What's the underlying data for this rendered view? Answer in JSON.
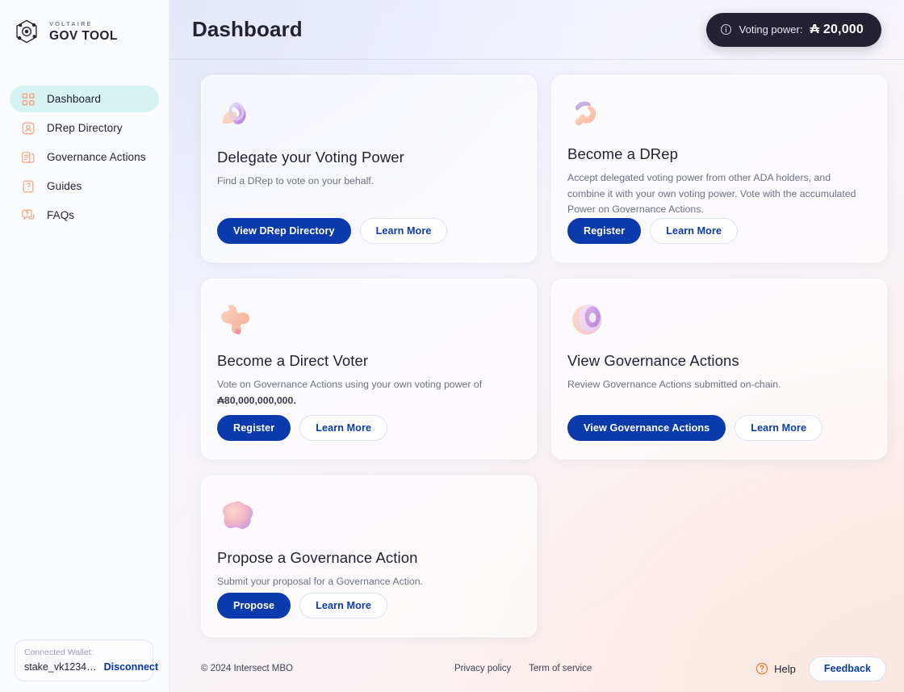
{
  "brand": {
    "eyebrow": "VOLTAIRE",
    "name": "GOV TOOL",
    "logo_icon": "hexagon-network-icon"
  },
  "sidebar": {
    "items": [
      {
        "label": "Dashboard",
        "icon": "grid-dashboard-icon",
        "active": true
      },
      {
        "label": "DRep Directory",
        "icon": "user-badge-icon",
        "active": false
      },
      {
        "label": "Governance Actions",
        "icon": "documents-icon",
        "active": false
      },
      {
        "label": "Guides",
        "icon": "question-page-icon",
        "active": false
      },
      {
        "label": "FAQs",
        "icon": "chat-question-icon",
        "active": false
      }
    ],
    "wallet": {
      "label": "Connected Wallet:",
      "address": "stake_vk1234…",
      "disconnect_label": "Disconnect"
    }
  },
  "header": {
    "title": "Dashboard",
    "voting_power": {
      "icon": "info-circle-icon",
      "label": "Voting power:",
      "currency_symbol": "₳",
      "amount": "20,000"
    }
  },
  "cards": [
    {
      "id": "delegate-voting-power",
      "illustration": "ribbon-loop-illustration",
      "title": "Delegate your Voting Power",
      "description": "Find a DRep to vote on your behalf.",
      "primary_label": "View DRep Directory",
      "secondary_label": "Learn More"
    },
    {
      "id": "become-a-drep",
      "illustration": "coral-swirl-illustration",
      "title": "Become a DRep",
      "description": "Accept delegated voting power from other ADA holders, and combine it with your own voting power. Vote with the accumulated Power on  Governance Actions.",
      "primary_label": "Register",
      "secondary_label": "Learn More"
    },
    {
      "id": "become-a-direct-voter",
      "illustration": "peach-blob-illustration",
      "title": "Become a Direct Voter",
      "description": "Vote on Governance Actions using your own voting power of ",
      "description_strong": "₳80,000,000,000.",
      "primary_label": "Register",
      "secondary_label": "Learn More"
    },
    {
      "id": "view-governance-actions",
      "illustration": "layered-sphere-illustration",
      "title": "View Governance Actions",
      "description": "Review Governance Actions submitted on-chain.",
      "primary_label": "View Governance Actions",
      "secondary_label": "Learn More"
    },
    {
      "id": "propose-a-governance-action",
      "illustration": "pink-cluster-illustration",
      "title": "Propose a Governance Action",
      "description": "Submit your proposal for a Governance Action.",
      "primary_label": "Propose",
      "secondary_label": "Learn More"
    }
  ],
  "footer": {
    "copyright": "© 2024 Intersect MBO",
    "links": [
      "Privacy policy",
      "Term of service"
    ],
    "help_label": "Help",
    "help_icon": "question-circle-icon",
    "feedback_label": "Feedback"
  },
  "colors": {
    "accent_blue": "#0B3AAD",
    "active_nav": "#D6F2F1",
    "dark": "#242232",
    "help_orange": "#F4792B"
  }
}
